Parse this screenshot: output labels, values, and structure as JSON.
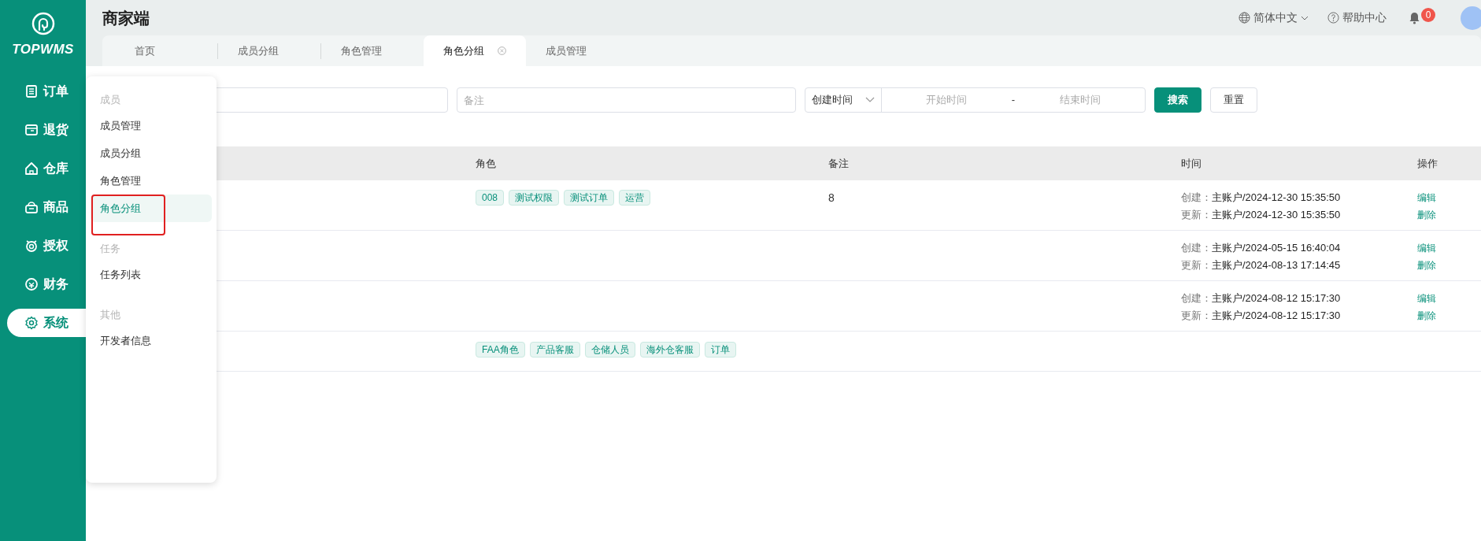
{
  "header": {
    "title": "商家端",
    "language": "简体中文",
    "help": "帮助中心",
    "notification_count": "0"
  },
  "sidebar": {
    "logo": "TOPWMS",
    "items": [
      {
        "label": "订单",
        "selected": false
      },
      {
        "label": "退货",
        "selected": false
      },
      {
        "label": "仓库",
        "selected": false
      },
      {
        "label": "商品",
        "selected": false
      },
      {
        "label": "授权",
        "selected": false
      },
      {
        "label": "财务",
        "selected": false
      },
      {
        "label": "系统",
        "selected": true
      }
    ]
  },
  "tabs": [
    {
      "label": "首页",
      "selected": false,
      "closable": false
    },
    {
      "label": "成员分组",
      "selected": false,
      "closable": false
    },
    {
      "label": "角色管理",
      "selected": false,
      "closable": false
    },
    {
      "label": "角色分组",
      "selected": true,
      "closable": true
    },
    {
      "label": "成员管理",
      "selected": false,
      "closable": false
    }
  ],
  "filters": {
    "remark_placeholder": "备注",
    "date_type": "创建时间",
    "start_placeholder": "开始时间",
    "separator": "-",
    "end_placeholder": "结束时间",
    "buttons": [
      {
        "label": "搜索",
        "kind": "primary"
      },
      {
        "label": "重置",
        "kind": "default"
      }
    ]
  },
  "table": {
    "columns": [
      "角色",
      "备注",
      "时间",
      "操作"
    ],
    "rows": [
      {
        "roles": [
          "008",
          "测试权限",
          "测试订单",
          "运营"
        ],
        "remark": "8",
        "times": [
          {
            "label": "创建：",
            "value": "主账户/2024-12-30 15:35:50"
          },
          {
            "label": "更新：",
            "value": "主账户/2024-12-30 15:35:50"
          }
        ],
        "actions": [
          "编辑",
          "删除"
        ]
      },
      {
        "roles": [],
        "remark": "",
        "times": [
          {
            "label": "创建：",
            "value": "主账户/2024-05-15 16:40:04"
          },
          {
            "label": "更新：",
            "value": "主账户/2024-08-13 17:14:45"
          }
        ],
        "actions": [
          "编辑",
          "删除"
        ]
      },
      {
        "roles": [],
        "remark": "",
        "times": [
          {
            "label": "创建：",
            "value": "主账户/2024-08-12 15:17:30"
          },
          {
            "label": "更新：",
            "value": "主账户/2024-08-12 15:17:30"
          }
        ],
        "actions": [
          "编辑",
          "删除"
        ]
      },
      {
        "roles": [
          "FAA角色",
          "产品客服",
          "仓储人员",
          "海外仓客服",
          "订单"
        ],
        "remark": "",
        "times": [],
        "actions": []
      }
    ]
  },
  "flyout_menu": {
    "groups": [
      {
        "title": "成员",
        "items": [
          {
            "label": "成员管理",
            "selected": false,
            "annotated": false
          },
          {
            "label": "成员分组",
            "selected": false,
            "annotated": false
          },
          {
            "label": "角色管理",
            "selected": false,
            "annotated": false
          },
          {
            "label": "角色分组",
            "selected": true,
            "annotated": true
          }
        ]
      },
      {
        "title": "任务",
        "items": [
          {
            "label": "任务列表",
            "selected": false,
            "annotated": false
          }
        ]
      },
      {
        "title": "其他",
        "items": [
          {
            "label": "开发者信息",
            "selected": false,
            "annotated": false
          }
        ]
      }
    ]
  }
}
